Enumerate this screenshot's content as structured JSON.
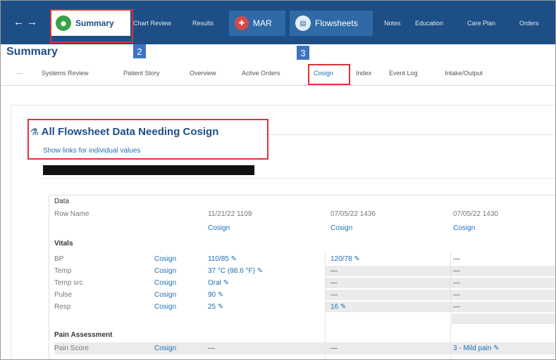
{
  "nav": {
    "arrows": "←→"
  },
  "tabs": {
    "summary": "Summary",
    "chart_review": "Chart Review",
    "results": "Results",
    "mar": "MAR",
    "flowsheets": "Flowsheets",
    "notes": "Notes",
    "education": "Education",
    "care_plan": "Care Plan",
    "orders": "Orders"
  },
  "badges": {
    "b2": "2",
    "b3": "3"
  },
  "page_title": "Summary",
  "subtabs": {
    "systems_review": "Systems Review",
    "patient_story": "Patient Story",
    "overview": "Overview",
    "active_orders": "Active Orders",
    "cosign": "Cosign",
    "index": "Index",
    "event_log": "Event Log",
    "intake_output": "Intake/Output"
  },
  "section": {
    "heading": "All Flowsheet Data Needing Cosign",
    "show_links": "Show links for individual values"
  },
  "table": {
    "data_label": "Data",
    "row_name_label": "Row Name",
    "columns": [
      {
        "datetime": "11/21/22 1109",
        "cosign": "Cosign"
      },
      {
        "datetime": "07/05/22 1436",
        "cosign": "Cosign"
      },
      {
        "datetime": "07/05/22 1430",
        "cosign": "Cosign"
      }
    ],
    "groups": [
      {
        "name": "Vitals",
        "rows": [
          {
            "label": "BP",
            "cosign": "Cosign",
            "values": [
              "110/85",
              "120/78",
              "—"
            ]
          },
          {
            "label": "Temp",
            "cosign": "Cosign",
            "values": [
              "37 °C (98.6 °F)",
              "—",
              "—"
            ]
          },
          {
            "label": "Temp src",
            "cosign": "Cosign",
            "values": [
              "Oral",
              "—",
              "—"
            ]
          },
          {
            "label": "Pulse",
            "cosign": "Cosign",
            "values": [
              "90",
              "—",
              "—"
            ]
          },
          {
            "label": "Resp",
            "cosign": "Cosign",
            "values": [
              "25",
              "16",
              "—"
            ]
          }
        ]
      },
      {
        "name": "Pain Assessment",
        "rows": [
          {
            "label": "Pain Score",
            "cosign": "Cosign",
            "values": [
              "—",
              "—",
              "3 - Mild pain"
            ]
          }
        ]
      }
    ]
  },
  "colors": {
    "nav_bg": "#1d4f86",
    "link": "#1d6fb8",
    "annotation_red": "#e0313b",
    "badge_blue": "#3d73c3"
  }
}
